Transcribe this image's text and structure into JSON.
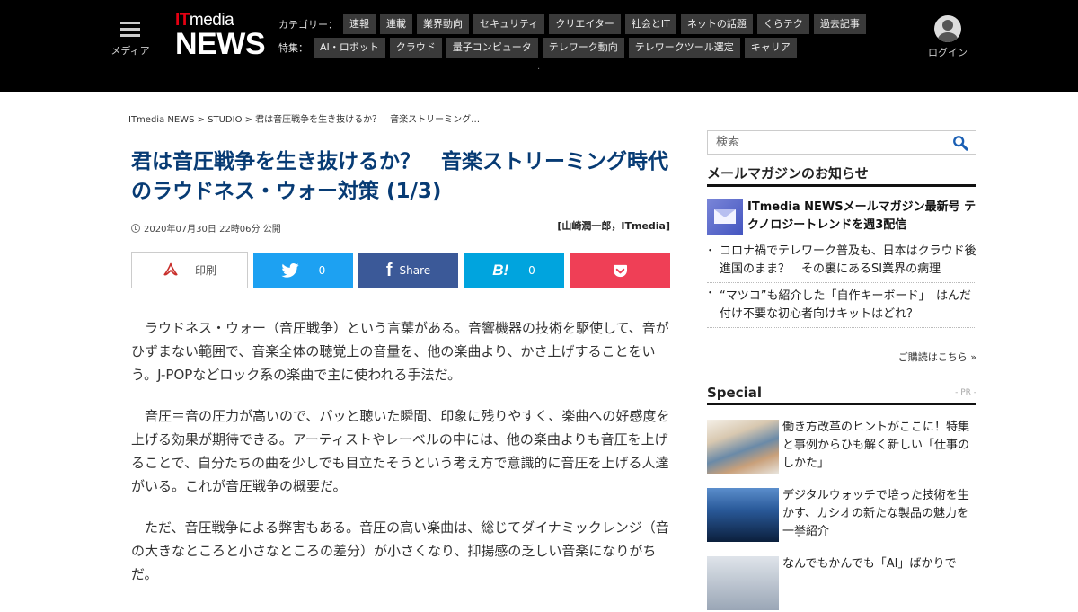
{
  "header": {
    "menu_label": "メディア",
    "logo_it": "IT",
    "logo_media": "media",
    "logo_news": "NEWS",
    "category_label": "カテゴリー：",
    "categories": [
      "速報",
      "連載",
      "業界動向",
      "セキュリティ",
      "クリエイター",
      "社会とIT",
      "ネットの話題",
      "くらテク",
      "過去記事"
    ],
    "feature_label": "特集：",
    "features": [
      "AI・ロボット",
      "クラウド",
      "量子コンピュータ",
      "テレワーク動向",
      "テレワークツール選定",
      "キャリア"
    ],
    "login_label": "ログイン"
  },
  "breadcrumb": "ITmedia NEWS > STUDIO > 君は音圧戦争を生き抜けるか？　音楽ストリーミング…",
  "article": {
    "title": "君は音圧戦争を生き抜けるか？　音楽ストリーミング時代のラウドネス・ウォー対策 (1/3)",
    "date": "2020年07月30日 22時06分 公開",
    "author": "[山崎潤一郎，ITmedia]",
    "paragraphs": [
      "ラウドネス・ウォー（音圧戦争）という言葉がある。音響機器の技術を駆使して、音がひずまない範囲で、音楽全体の聴覚上の音量を、他の楽曲より、かさ上げすることをいう。J-POPなどロック系の楽曲で主に使われる手法だ。",
      "音圧＝音の圧力が高いので、パッと聴いた瞬間、印象に残りやすく、楽曲への好感度を上げる効果が期待できる。アーティストやレーベルの中には、他の楽曲よりも音圧を上げることで、自分たちの曲を少しでも目立たそうという考え方で意識的に音圧を上げる人達がいる。これが音圧戦争の概要だ。",
      "ただ、音圧戦争による弊害もある。音圧の高い楽曲は、総じてダイナミックレンジ（音の大きなところと小さなところの差分）が小さくなり、抑揚感の乏しい音楽になりがちだ。"
    ]
  },
  "share": {
    "print_label": "印刷",
    "twitter_count": "0",
    "facebook_label": "Share",
    "hatena_count": "0",
    "hatena_icon_text": "B!",
    "facebook_icon_text": "f",
    "colors": {
      "twitter": "#1da1f2",
      "facebook": "#3b5998",
      "hatena": "#00a4de",
      "pocket": "#ef3f56"
    }
  },
  "sidebar": {
    "search_placeholder": "検索",
    "mailmag_heading": "メールマガジンのお知らせ",
    "mailmag_feature": "ITmedia NEWSメールマガジン最新号 テクノロジートレンドを週3配信",
    "mailmag_items": [
      "コロナ禍でテレワーク普及も、日本はクラウド後進国のまま？　その裏にあるSI業界の病理",
      "“マツコ”も紹介した「自作キーボード」　はんだ付け不要な初心者向けキットはどれ？"
    ],
    "subscribe_link": "ご購読はこちら »",
    "special_heading": "Special",
    "pr_label": "- PR -",
    "special_items": [
      "働き方改革のヒントがここに！特集と事例からひも解く新しい「仕事のしかた」",
      "デジタルウォッチで培った技術を生かす、カシオの新たな製品の魅力を一挙紹介",
      "なんでもかんでも「AI」ばかりで"
    ]
  },
  "colors": {
    "title": "#073b74",
    "header_bg": "#000000",
    "logo_accent": "#e60012"
  }
}
